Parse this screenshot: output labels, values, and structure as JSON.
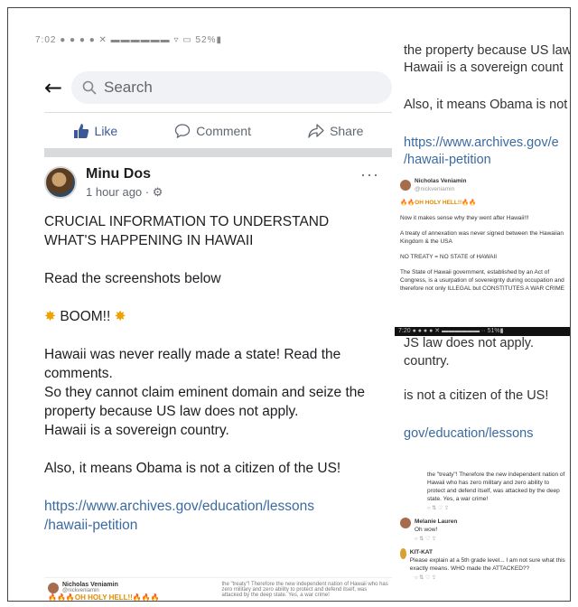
{
  "statusbar": "7:02 ● ● ● ● ✕ ▬▬▬▬▬▬   ▿  ▭ 52%▮",
  "search": {
    "placeholder": "Search"
  },
  "actions": {
    "like": "Like",
    "comment": "Comment",
    "share": "Share"
  },
  "post": {
    "author": "Minu Dos",
    "time": "1 hour ago · ⚙",
    "more": "···",
    "headline": "CRUCIAL INFORMATION TO UNDERSTAND WHAT'S HAPPENING IN HAWAII",
    "read": "Read the screenshots below",
    "boom": "BOOM!!",
    "lines": [
      "Hawaii was never really made a state!  Read the comments.",
      "So they cannot claim eminent domain and seize the property because US law does not apply.",
      "Hawaii is a sovereign country."
    ],
    "obama": "Also, it means Obama is not a citizen of the US!",
    "link_line1": "https://www.archives.gov/education/lessons",
    "link_line2": "/hawaii-petition"
  },
  "embed": {
    "left_name": "Nicholas Veniamin",
    "left_handle": "@nickveniamin",
    "left_emoji": "🔥🔥🔥OH HOLY HELL!!🔥🔥🔥",
    "right_text": "the \"treaty\"! Therefore the new independent nation of Hawaii who has zero military and zero ability to protect and defend itself, was attacked by the deep state. Yes, a war crime!"
  },
  "right": {
    "t1": "the property because US law",
    "t2": "Hawaii is a sovereign count",
    "t3": "Also, it means Obama is not",
    "l1": "https://www.archives.gov/e",
    "l2": "/hawaii-petition",
    "shot_name": "Nicholas Veniamin",
    "shot_handle": "@nickveniamin",
    "shot_emoji": "🔥🔥OH HOLY HELL!!🔥🔥",
    "shot_p1": "Now it makes sense why they went after Hawaii!!!",
    "shot_p2": "A treaty of annexation was never signed between the Hawaiian Kingdom & the USA",
    "shot_p3": "NO TREATY = NO STATE of HAWAII",
    "shot_p4": "The State of Hawaii government, established by an Act of Congress, is a usurpation of sovereignty during occupation and therefore not only ILLEGAL but CONSTITUTES A WAR CRIME",
    "darkbar": "7:20 ● ● ● ● ✕ ▬▬▬▬▬▬ ·· 51%▮",
    "t4": "JS law does not apply.",
    "t5": "country.",
    "t6": "is not a citizen of the US!",
    "l3": "gov/education/lessons",
    "shot2_text": "the \"treaty\"! Therefore the new independent nation of Hawaii who has zero military and zero ability to protect and defend itself, was attacked by the deep state. Yes, a war crime!",
    "c1_name": "Melanie Lauren",
    "c1_text": "Oh wow!",
    "c2_name": "KIT-KAT",
    "c2_text": "Please explain at a 5th grade level... I am not sure what this exactly means. WHO made the ATTACKED??"
  }
}
